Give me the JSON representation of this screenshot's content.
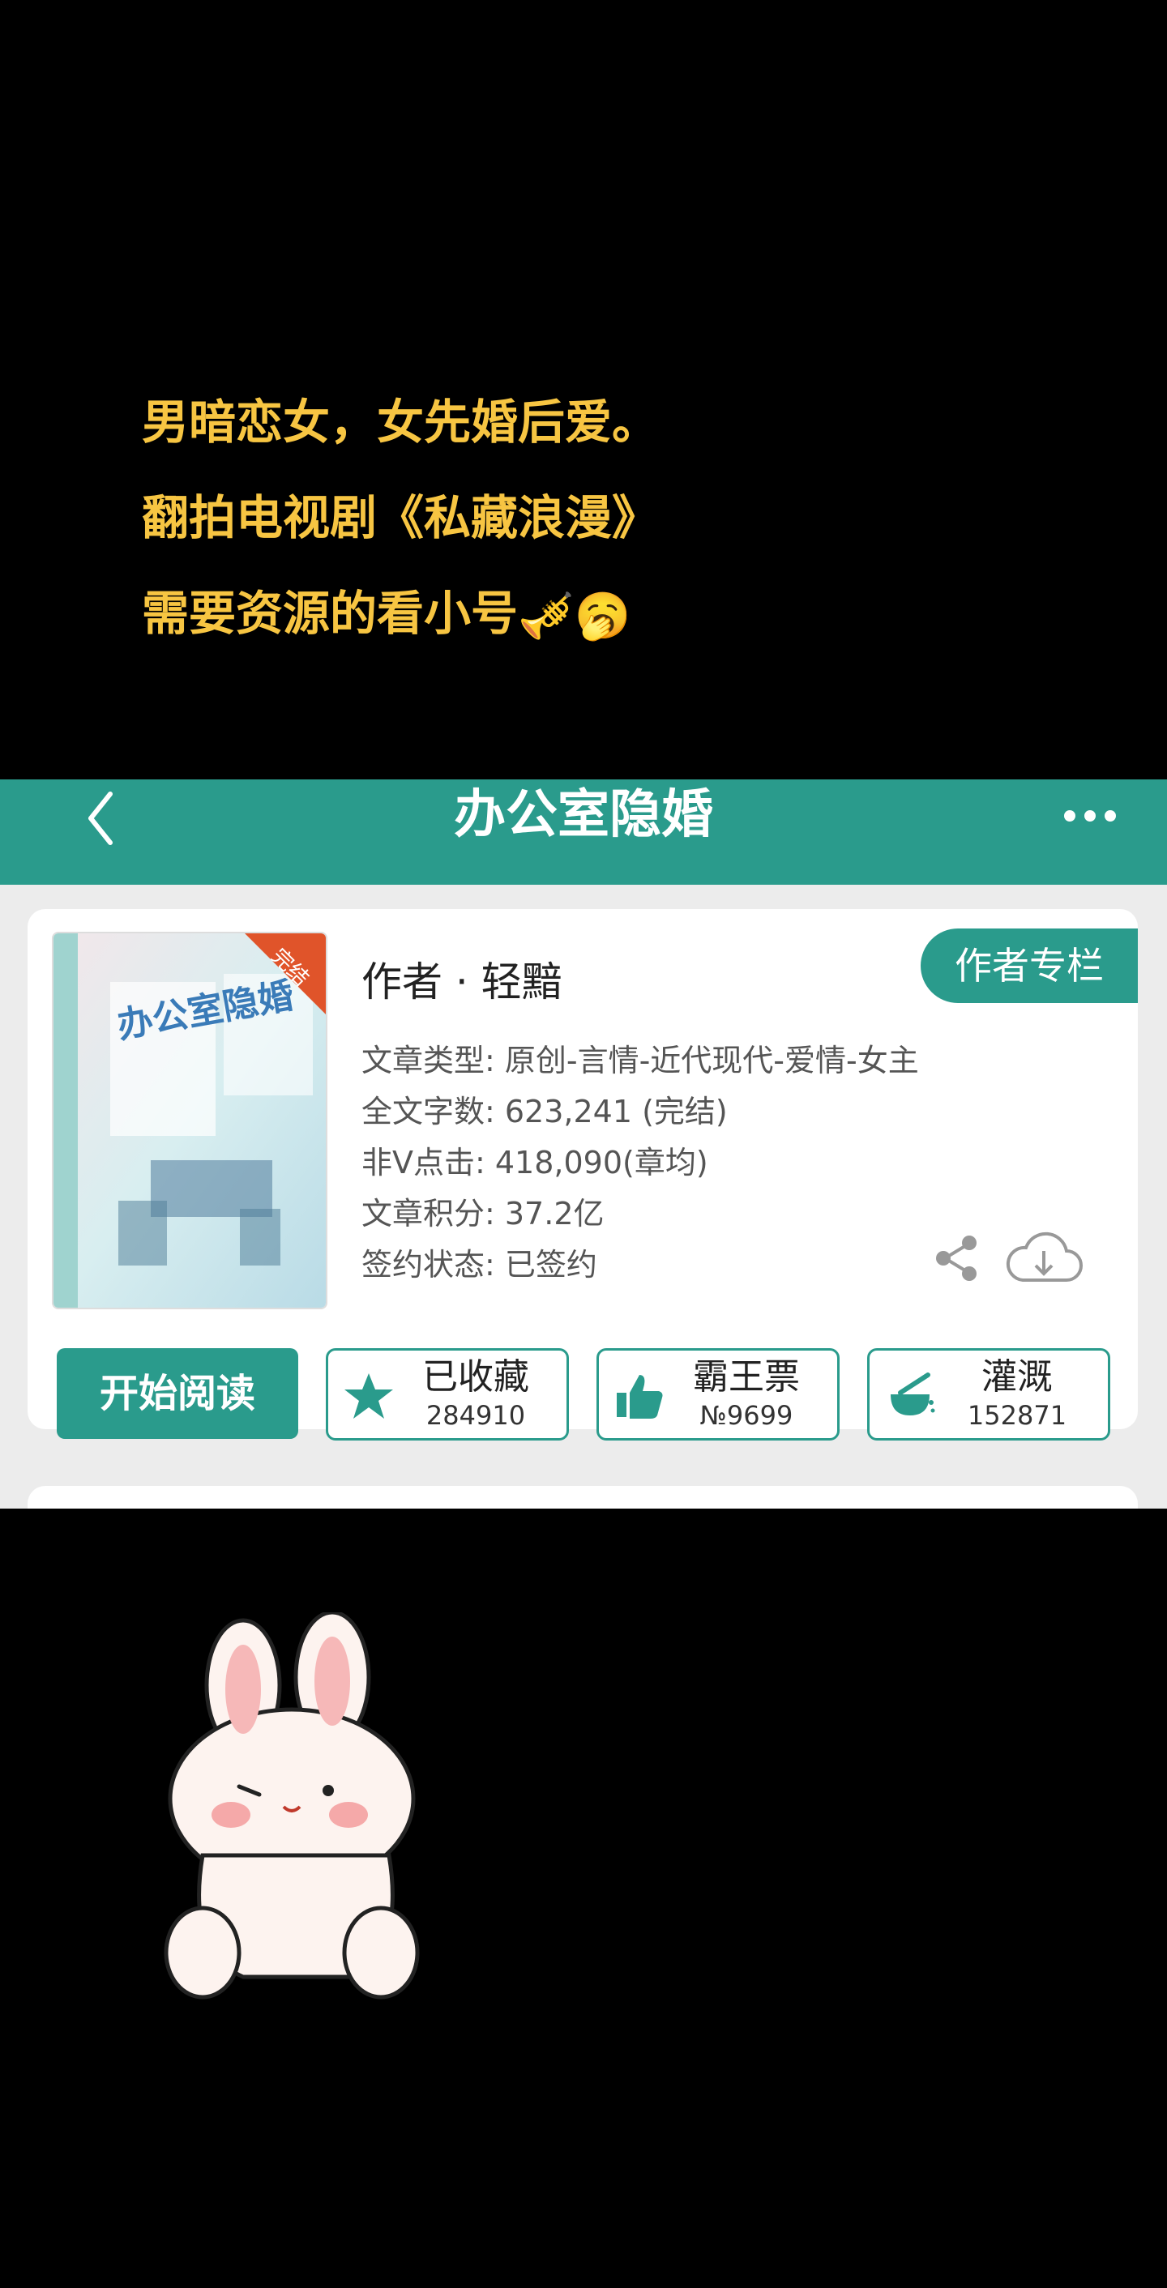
{
  "caption": {
    "lines": [
      "男暗恋女，女先婚后爱。",
      "翻拍电视剧《私藏浪漫》",
      "需要资源的看小号"
    ],
    "emojis": [
      "🎺",
      "🥱"
    ]
  },
  "nav": {
    "title": "办公室隐婚"
  },
  "book": {
    "cover_badge": "完结",
    "cover_title": "办公室隐婚",
    "author": "作者 · 轻黯",
    "column_button": "作者专栏",
    "info": [
      "文章类型: 原创-言情-近代现代-爱情-女主",
      "全文字数: 623,241 (完结)",
      "非Ⅴ点击: 418,090(章均)",
      "文章积分: 37.2亿",
      "签约状态: 已签约"
    ]
  },
  "actions": {
    "read": "开始阅读",
    "collect": {
      "label": "已收藏",
      "count": "284910"
    },
    "ticket": {
      "label": "霸王票",
      "count": "№9699"
    },
    "water": {
      "label": "灌溉",
      "count": "152871"
    }
  },
  "colors": {
    "brand": "#2a9b8c",
    "caption": "#f7c542"
  },
  "icons": [
    "back-icon",
    "more-icon",
    "share-icon",
    "download-icon",
    "star-icon",
    "thumbs-up-icon",
    "watering-icon"
  ]
}
